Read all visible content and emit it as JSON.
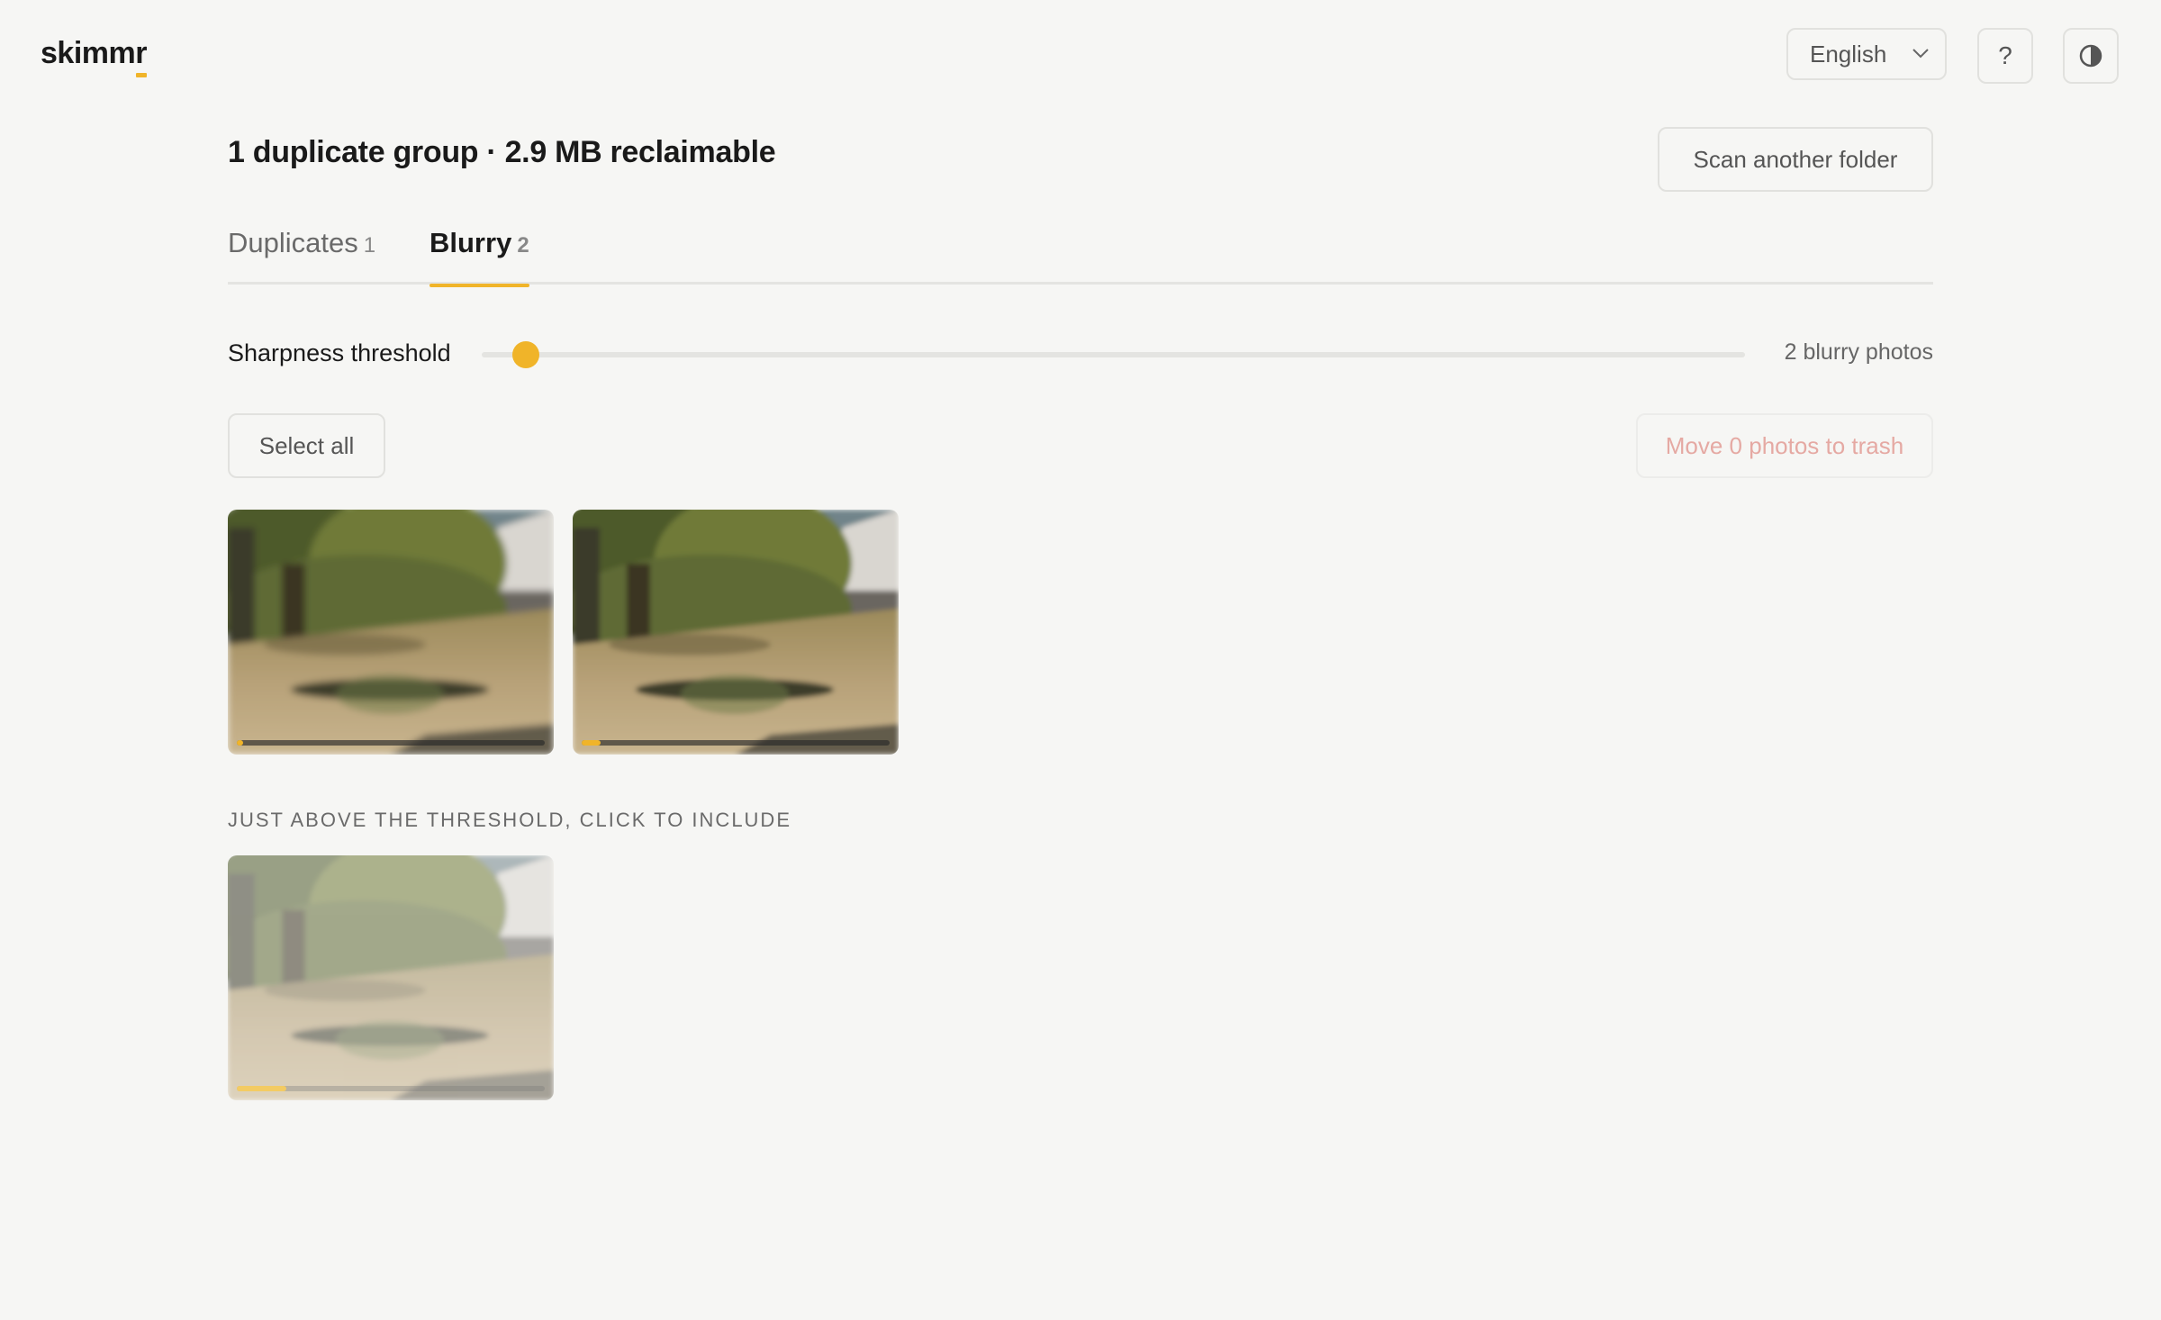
{
  "app": {
    "logo_main": "skimm",
    "logo_accent": "r"
  },
  "header": {
    "language": {
      "selected": "English",
      "options": [
        "English"
      ]
    },
    "help_label": "?",
    "theme_icon": "contrast-icon"
  },
  "summary": {
    "headline": "1 duplicate group · 2.9 MB reclaimable",
    "scan_button": "Scan another folder"
  },
  "tabs": [
    {
      "label": "Duplicates",
      "count": "1",
      "active": false
    },
    {
      "label": "Blurry",
      "count": "2",
      "active": true
    }
  ],
  "threshold": {
    "label": "Sharpness threshold",
    "value_fraction": 0.035,
    "result_text": "2 blurry photos"
  },
  "actions": {
    "select_all": "Select all",
    "trash": "Move 0 photos to trash"
  },
  "blurry_photos": [
    {
      "sharpness_fraction": 0.02
    },
    {
      "sharpness_fraction": 0.06
    }
  ],
  "near_threshold": {
    "caption": "Just above the threshold, click to include",
    "photos": [
      {
        "sharpness_fraction": 0.16
      }
    ]
  },
  "colors": {
    "accent": "#f0b429",
    "danger_disabled": "#e5a9a3",
    "background": "#f6f6f4"
  }
}
